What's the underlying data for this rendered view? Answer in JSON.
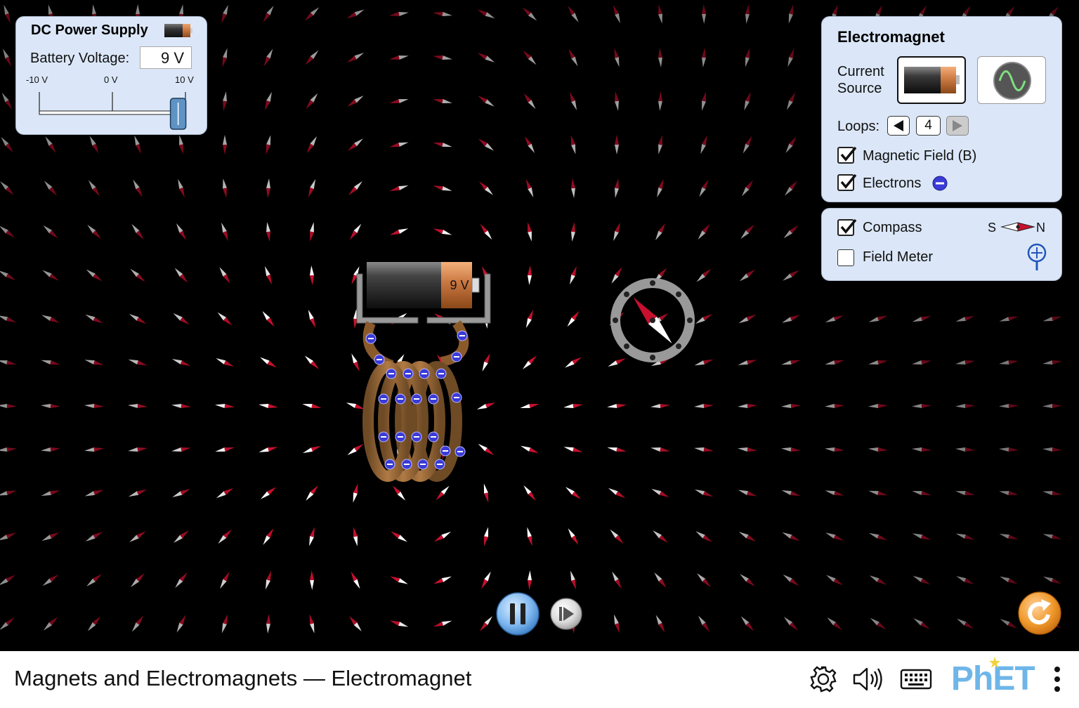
{
  "dc_power_supply": {
    "title": "DC Power Supply",
    "voltage_label": "Battery Voltage:",
    "voltage_value": "9 V",
    "ticks": [
      "-10 V",
      "0 V",
      "10 V"
    ],
    "slider_min": -10,
    "slider_max": 10,
    "slider_value": 9
  },
  "electromagnet_panel": {
    "title": "Electromagnet",
    "current_source_label_1": "Current",
    "current_source_label_2": "Source",
    "loops_label": "Loops:",
    "loops_value": "4",
    "magnetic_field_label": "Magnetic Field (B)",
    "magnetic_field_checked": true,
    "electrons_label": "Electrons",
    "electrons_checked": true
  },
  "tools_panel": {
    "compass_label": "Compass",
    "compass_checked": true,
    "compass_s": "S",
    "compass_n": "N",
    "field_meter_label": "Field Meter",
    "field_meter_checked": false
  },
  "battery_label": "9 V",
  "bottom_bar": {
    "sim_title": "Magnets and Electromagnets — Electromagnet",
    "logo": "PhET"
  },
  "colors": {
    "panel_bg": "#dbe7f8",
    "needle_north": "#c8102e",
    "needle_south": "#ffffff",
    "electron": "#3b3bd6",
    "coil": "#a8743f",
    "play_button": "#7fb8f0",
    "reset_button": "#f09a2c",
    "phet_blue": "#6fb6e8",
    "phet_yellow": "#f2d23a"
  }
}
